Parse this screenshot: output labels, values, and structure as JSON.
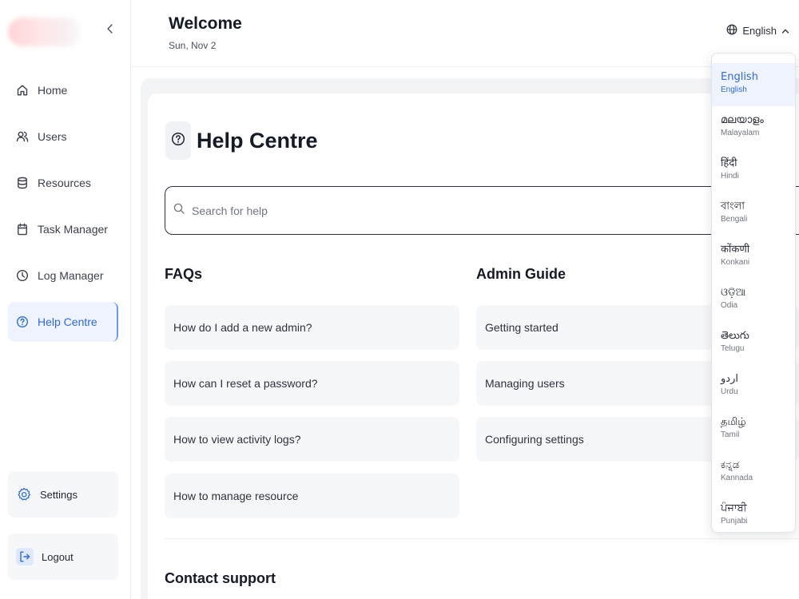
{
  "header": {
    "title": "Welcome",
    "date": "Sun, Nov 2",
    "language_label": "English"
  },
  "sidebar": {
    "items": [
      {
        "label": "Home",
        "icon": "home-icon"
      },
      {
        "label": "Users",
        "icon": "users-icon"
      },
      {
        "label": "Resources",
        "icon": "database-icon"
      },
      {
        "label": "Task Manager",
        "icon": "clipboard-icon"
      },
      {
        "label": "Log Manager",
        "icon": "clock-icon"
      },
      {
        "label": "Help Centre",
        "icon": "help-circle-icon",
        "active": true
      }
    ],
    "settings_label": "Settings",
    "logout_label": "Logout"
  },
  "main": {
    "title": "Help Centre",
    "search_placeholder": "Search for help",
    "faqs": {
      "title": "FAQs",
      "items": [
        "How do I add a new admin?",
        "How can I reset a password?",
        "How to view activity logs?",
        "How to manage resource"
      ]
    },
    "admin_guide": {
      "title": "Admin Guide",
      "items": [
        "Getting started",
        "Managing users",
        "Configuring settings"
      ]
    },
    "contact_title": "Contact support"
  },
  "languages": [
    {
      "native": "English",
      "english": "English",
      "selected": true
    },
    {
      "native": "മലയാളം",
      "english": "Malayalam"
    },
    {
      "native": "हिंदी",
      "english": "Hindi"
    },
    {
      "native": "বাংলা",
      "english": "Bengali"
    },
    {
      "native": "कोंकणी",
      "english": "Konkani"
    },
    {
      "native": "ଓଡ଼ିଆ",
      "english": "Odia"
    },
    {
      "native": "తెలుగు",
      "english": "Telugu"
    },
    {
      "native": "اردو",
      "english": "Urdu"
    },
    {
      "native": "தமிழ்",
      "english": "Tamil"
    },
    {
      "native": "ಕನ್ನಡ",
      "english": "Kannada"
    },
    {
      "native": "ਪੰਜਾਬੀ",
      "english": "Punjabi"
    }
  ],
  "colors": {
    "accent": "#2f6bd8",
    "active_bg": "#eef3fd",
    "card_bg": "#f6f7f9"
  }
}
